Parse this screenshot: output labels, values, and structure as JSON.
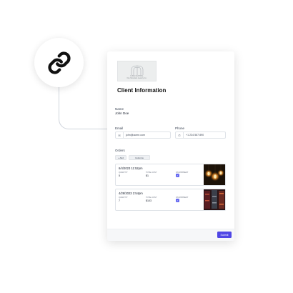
{
  "logo": {
    "line1": "FUNE CENTRAL",
    "line2": "Fire Mountain Jewelry Co."
  },
  "client": {
    "title": "Client Information",
    "name_label": "Name",
    "name_value": "John Doe",
    "email_label": "Email",
    "email_value": "john@acme.com",
    "phone_label": "Phone",
    "phone_value": "+1 234 567 890"
  },
  "orders": {
    "label": "Orders",
    "add_label": "+ Add",
    "columns_label": "Columns",
    "items": [
      {
        "date": "6/4/2023 11:52pm",
        "quantity_header": "QUANTITY",
        "quantity": "5",
        "cost_header": "TOTAL COST",
        "cost": "$1",
        "shipping_header": "ON SHIPMENT"
      },
      {
        "date": "4/28/2023 2:54pm",
        "quantity_header": "QUANTITY",
        "quantity": "7",
        "cost_header": "TOTAL COST",
        "cost": "$103",
        "shipping_header": "ON SHIPMENT"
      }
    ]
  },
  "footer": {
    "submit_label": "Submit"
  },
  "colors": {
    "accent": "#4f46e5",
    "checkbox": "#6366f1"
  },
  "icons": {
    "badge": "link-icon",
    "email": "mail-icon",
    "phone": "phone-icon"
  }
}
